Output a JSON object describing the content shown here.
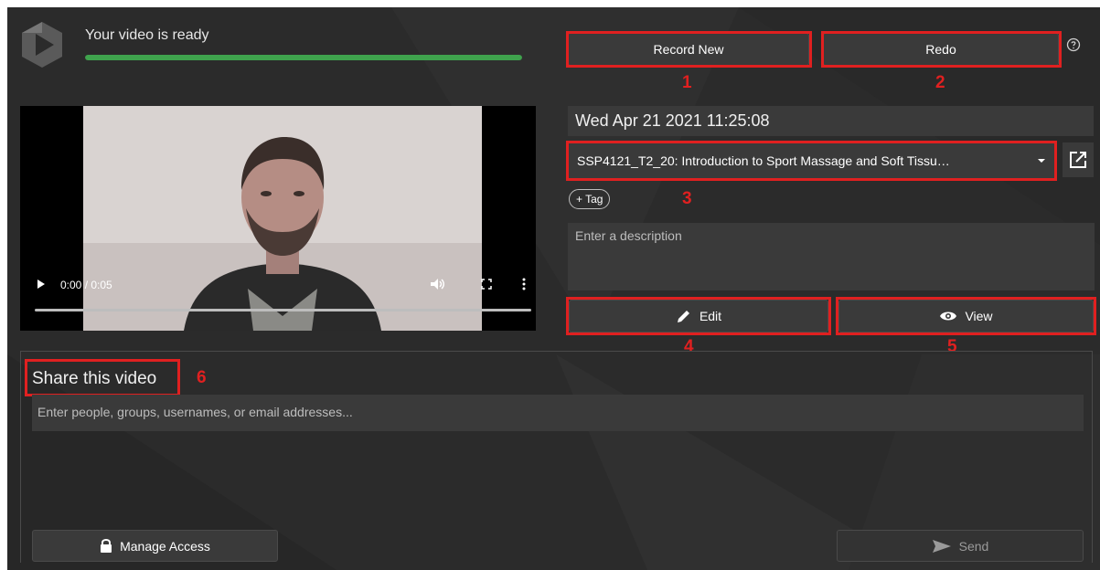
{
  "header": {
    "status_text": "Your video is ready",
    "upload_progress_percent": 100
  },
  "toolbar": {
    "record_new_label": "Record New",
    "redo_label": "Redo",
    "help_icon": "help-circle-icon"
  },
  "player": {
    "time_display": "0:00 / 0:05",
    "play_icon": "play-icon",
    "volume_icon": "volume-icon",
    "fullscreen_icon": "fullscreen-icon",
    "more_icon": "more-vertical-icon"
  },
  "details": {
    "datetime": "Wed Apr 21 2021 11:25:08",
    "folder": "SSP4121_T2_20: Introduction to Sport Massage and Soft Tissu…",
    "tag_label": "+ Tag",
    "description_placeholder": "Enter a description",
    "edit_label": "Edit",
    "view_label": "View"
  },
  "share": {
    "title": "Share this video",
    "input_placeholder": "Enter people, groups, usernames, or email addresses...",
    "manage_access_label": "Manage Access",
    "send_label": "Send"
  },
  "annotations": {
    "n1": "1",
    "n2": "2",
    "n3": "3",
    "n4": "4",
    "n5": "5",
    "n6": "6"
  },
  "colors": {
    "annotation": "#e02020",
    "progress": "#3fa34d",
    "panel": "#2b2b2b"
  }
}
